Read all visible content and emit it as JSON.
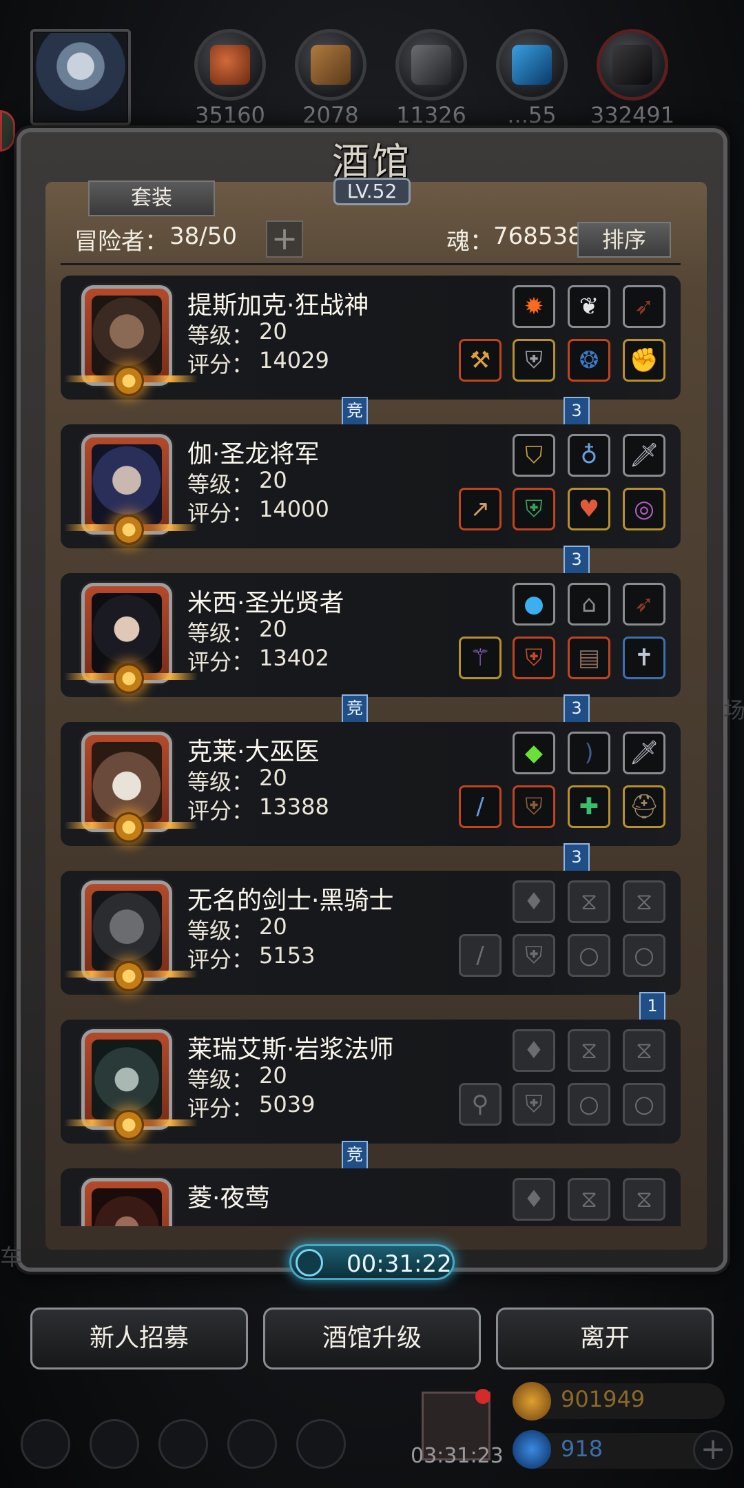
{
  "resources": [
    {
      "icon": "meat-icon",
      "value": "35160"
    },
    {
      "icon": "wood-icon",
      "value": "2078"
    },
    {
      "icon": "iron-icon",
      "value": "11326"
    },
    {
      "icon": "crystal-icon",
      "value": "...55"
    },
    {
      "icon": "ore-icon",
      "value": "332491"
    }
  ],
  "panel": {
    "title": "酒馆",
    "level": "LV.52",
    "tab_label": "套装",
    "adventurer_label": "冒险者：",
    "adventurer_count": "38/50",
    "add_symbol": "+",
    "soul_label": "魂：",
    "soul_value": "768538",
    "sort_label": "排序"
  },
  "labels": {
    "level": "等级：",
    "score": "评分："
  },
  "heroes": [
    {
      "name": "提斯加克·狂战神",
      "level": "20",
      "score": "14029",
      "ribbon_left": "竞",
      "ribbon_right": "3"
    },
    {
      "name": "伽·圣龙将军",
      "level": "20",
      "score": "14000",
      "ribbon_left": "",
      "ribbon_right": "3"
    },
    {
      "name": "米西·圣光贤者",
      "level": "20",
      "score": "13402",
      "ribbon_left": "竞",
      "ribbon_right": "3"
    },
    {
      "name": "克莱·大巫医",
      "level": "20",
      "score": "13388",
      "ribbon_left": "",
      "ribbon_right": "3"
    },
    {
      "name": "无名的剑士·黑骑士",
      "level": "20",
      "score": "5153",
      "ribbon_left": "",
      "ribbon_right": "1"
    },
    {
      "name": "莱瑞艾斯·岩浆法师",
      "level": "20",
      "score": "5039",
      "ribbon_left": "竞",
      "ribbon_right": ""
    },
    {
      "name": "菱·夜莺",
      "level": "",
      "score": "",
      "ribbon_left": "",
      "ribbon_right": ""
    }
  ],
  "timer": "00:31:22",
  "buttons": {
    "recruit": "新人招募",
    "upgrade": "酒馆升级",
    "leave": "离开"
  },
  "gift_timer": "03:31:23",
  "gold": "901949",
  "gems": "918",
  "edge_text": {
    "right": "场",
    "left": "车"
  },
  "colors": {
    "accent_gold": "#b8902e",
    "accent_red": "#c0451f",
    "ribbon_blue": "#1f4f86",
    "timer_cyan": "#4aa7c2"
  }
}
